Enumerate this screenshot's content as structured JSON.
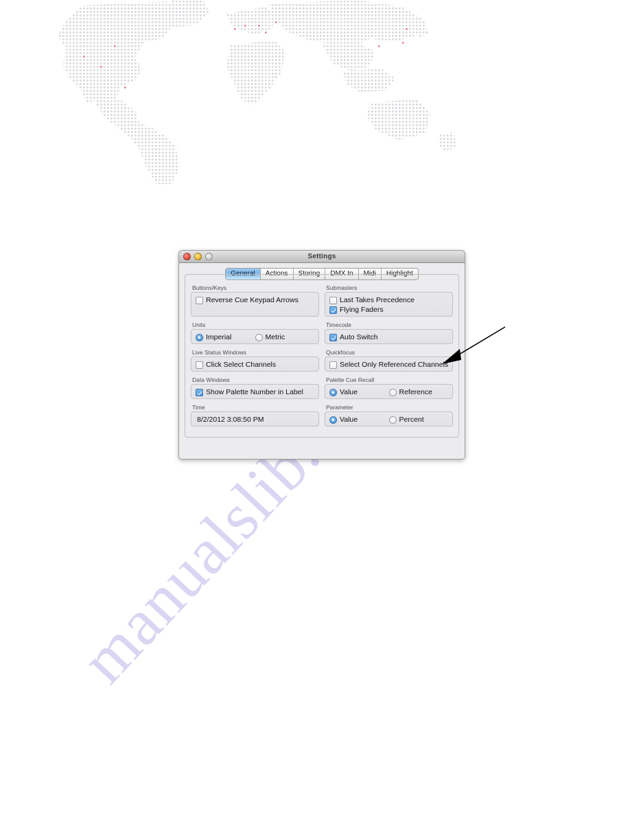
{
  "page": {
    "watermark_text": "manualslib.com",
    "background_map": "dotted-world-map"
  },
  "window": {
    "title": "Settings",
    "traffic_lights": [
      "close",
      "minimize",
      "zoom"
    ]
  },
  "tabs": [
    {
      "label": "General",
      "selected": true
    },
    {
      "label": "Actions",
      "selected": false
    },
    {
      "label": "Storing",
      "selected": false
    },
    {
      "label": "DMX In",
      "selected": false
    },
    {
      "label": "Midi",
      "selected": false
    },
    {
      "label": "Highlight",
      "selected": false
    }
  ],
  "left_column": {
    "buttons_keys": {
      "label": "Buttons/Keys",
      "options": [
        {
          "label": "Reverse Cue Keypad Arrows",
          "type": "checkbox",
          "checked": false
        }
      ]
    },
    "units": {
      "label": "Units",
      "options": [
        {
          "label": "Imperial",
          "type": "radio",
          "checked": true
        },
        {
          "label": "Metric",
          "type": "radio",
          "checked": false
        }
      ]
    },
    "live_status_windows": {
      "label": "Live Status Windows",
      "options": [
        {
          "label": "Click Select Channels",
          "type": "checkbox",
          "checked": false
        }
      ]
    },
    "data_windows": {
      "label": "Data Windows",
      "options": [
        {
          "label": "Show Palette Number in Label",
          "type": "checkbox",
          "checked": true
        }
      ]
    },
    "time": {
      "label": "Time",
      "value": "8/2/2012 3:08:50 PM"
    }
  },
  "right_column": {
    "submasters": {
      "label": "Submasters",
      "options": [
        {
          "label": "Last Takes Precedence",
          "type": "checkbox",
          "checked": false
        },
        {
          "label": "Flying Faders",
          "type": "checkbox",
          "checked": true
        }
      ]
    },
    "timecode": {
      "label": "Timecode",
      "options": [
        {
          "label": "Auto Switch",
          "type": "checkbox",
          "checked": true
        }
      ]
    },
    "quickfocus": {
      "label": "Quickfocus",
      "options": [
        {
          "label": "Select Only Referenced Channels",
          "type": "checkbox",
          "checked": false
        }
      ]
    },
    "palette_cue_recall": {
      "label": "Palette Cue Recall",
      "options": [
        {
          "label": "Value",
          "type": "radio",
          "checked": true
        },
        {
          "label": "Reference",
          "type": "radio",
          "checked": false
        }
      ]
    },
    "parameter": {
      "label": "Parameter",
      "options": [
        {
          "label": "Value",
          "type": "radio",
          "checked": true
        },
        {
          "label": "Percent",
          "type": "radio",
          "checked": false
        }
      ]
    }
  },
  "annotation": {
    "arrow_color": "#000000",
    "points_to": "Select Only Referenced Channels"
  }
}
